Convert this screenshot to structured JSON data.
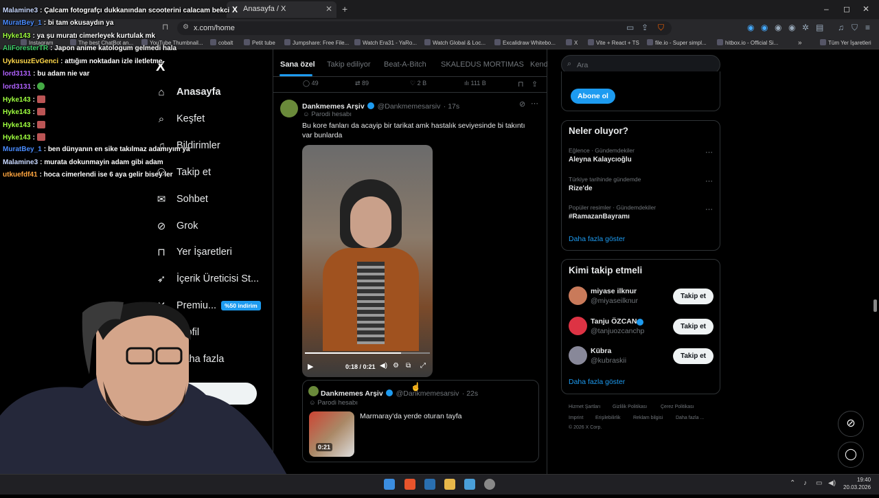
{
  "browser": {
    "tab_title": "Anasayfa / X",
    "url": "x.com/home",
    "bookmarks": [
      "Instagram",
      "The best ChatBot an...",
      "YouTube Thumbnail...",
      "cobalt",
      "Petit tube",
      "Jumpshare: Free File...",
      "Watch Era31 - YaRo...",
      "Watch Global & Loc...",
      "Excalidraw Whitebo...",
      "X",
      "Vite + React + TS",
      "file.io - Super simpl...",
      "hitbox.io - Official Si..."
    ],
    "bookmarks_all": "Tüm Yer İşaretleri"
  },
  "chat": [
    {
      "user": "Malamine3",
      "color": "#c8d8ff",
      "msg": "Çalcam fotografçı dukkanından scooterini calacam bekci"
    },
    {
      "user": "MuratBey_1",
      "color": "#4a8cff",
      "msg": "bi tam okusaydın ya"
    },
    {
      "user": "Hyke143",
      "color": "#9fff3f",
      "msg": "ya şu muratı cimerleyek kurtulak mk"
    },
    {
      "user": "AliForesterTR",
      "color": "#3fd06a",
      "msg": "Japon anime katologum gelmedi hala"
    },
    {
      "user": "UykusuzEvGenci",
      "color": "#ffd84a",
      "msg": "attığım noktadan izle iletletme"
    },
    {
      "user": "lord3131",
      "color": "#b062ff",
      "msg": "bu adam nie var"
    },
    {
      "user": "lord3131",
      "color": "#b062ff",
      "msg": ""
    },
    {
      "user": "Hyke143",
      "color": "#9fff3f",
      "msg": ""
    },
    {
      "user": "Hyke143",
      "color": "#9fff3f",
      "msg": ""
    },
    {
      "user": "Hyke143",
      "color": "#9fff3f",
      "msg": ""
    },
    {
      "user": "Hyke143",
      "color": "#9fff3f",
      "msg": ""
    },
    {
      "user": "MuratBey_1",
      "color": "#4a8cff",
      "msg": "ben dünyanın en sike takılmaz adamıyım ya"
    },
    {
      "user": "Malamine3",
      "color": "#c8d8ff",
      "msg": "murata dokunmayin adam gibi adam"
    },
    {
      "user": "utkuefdf41",
      "color": "#ffa53f",
      "msg": "hoca cimerlendi ise 6 aya gelir bisey ler"
    }
  ],
  "nav": [
    {
      "label": "Anasayfa",
      "icon": "home-icon",
      "glyph": "⌂"
    },
    {
      "label": "Keşfet",
      "icon": "search-icon",
      "glyph": "⌕"
    },
    {
      "label": "Bildirimler",
      "icon": "bell-icon",
      "glyph": "♫"
    },
    {
      "label": "Takip et",
      "icon": "follow-icon",
      "glyph": "⚇"
    },
    {
      "label": "Sohbet",
      "icon": "mail-icon",
      "glyph": "✉"
    },
    {
      "label": "Grok",
      "icon": "grok-icon",
      "glyph": "⊘"
    },
    {
      "label": "Yer İşaretleri",
      "icon": "bookmark-icon",
      "glyph": "⊓"
    },
    {
      "label": "İçerik Üreticisi St...",
      "icon": "rocket-icon",
      "glyph": "➶"
    },
    {
      "label": "Premiu...",
      "icon": "premium-icon",
      "glyph": "✕"
    },
    {
      "label": "Profil",
      "icon": "profile-icon",
      "glyph": "☺"
    },
    {
      "label": "Daha fazla",
      "icon": "more-icon",
      "glyph": "⋯"
    }
  ],
  "premium_badge": "%50 indirim",
  "feed": {
    "tabs": [
      "Sana özel",
      "Takip ediliyor",
      "Beat-A-Bitch",
      "SKALEDUS MORTIMAS",
      "Kend"
    ],
    "prev_actions": {
      "replies": "49",
      "reposts": "89",
      "likes": "2 B",
      "views": "111 B"
    },
    "post": {
      "name": "Dankmemes Arşiv",
      "handle": "@Dankmemesarsiv",
      "time": "· 17s",
      "label": "Parodi hesabı",
      "text": "Bu kore fanları da acayip bir tarikat amk hastalık seviyesinde bi takıntı var bunlarda",
      "video_time": "0:18 / 0:21",
      "video_progress": 0.77
    },
    "quote": {
      "name": "Dankmemes Arşiv",
      "handle": "@Dankmemesarsiv",
      "time": "· 22s",
      "label": "Parodi hesabı",
      "text": "Marmaray'da yerde oturan tayfa",
      "thumb_time": "0:21"
    }
  },
  "right": {
    "search_placeholder": "Ara",
    "subscribe": "Abone ol",
    "trends_title": "Neler oluyor?",
    "trends": [
      {
        "cat": "Eğlence · Gündemdekiler",
        "name": "Aleyna Kalaycıoğlu"
      },
      {
        "cat": "Türkiye tarihinde gündemde",
        "name": "Rize'de"
      },
      {
        "cat": "Popüler resimler · Gündemdekiler",
        "name": "#RamazanBayramı"
      }
    ],
    "show_more": "Daha fazla göster",
    "who_title": "Kimi takip etmeli",
    "who": [
      {
        "name": "miyase ilknur",
        "handle": "@miyaseilknur",
        "color": "#c97a5a"
      },
      {
        "name": "Tanju ÖZCAN",
        "handle": "@tanjuozcanchp",
        "color": "#d34"
      },
      {
        "name": "Kübra",
        "handle": "@kubraskii",
        "color": "#889"
      }
    ],
    "follow": "Takip et",
    "footer": [
      "Hizmet Şartları",
      "Gizlilik Politikası",
      "Çerez Politikası",
      "Imprint",
      "Erişilebilirlik",
      "Reklam bilgisi",
      "Daha fazla ...",
      "© 2026 X Corp."
    ]
  },
  "taskbar": {
    "time": "19:40",
    "date": "20.03.2026"
  }
}
